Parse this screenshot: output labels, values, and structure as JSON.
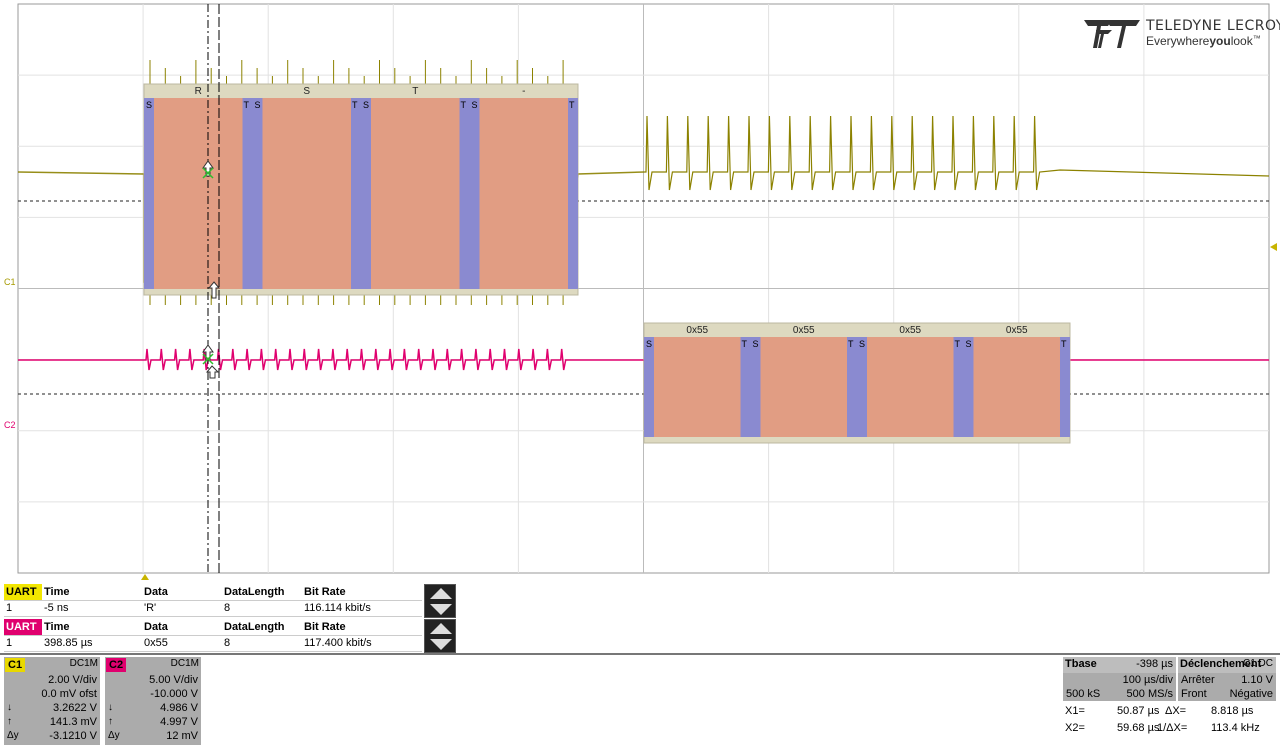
{
  "brand": {
    "name": "TELEDYNE LECROY",
    "tagline_a": "Everywhere",
    "tagline_b": "you",
    "tagline_c": "look",
    "tm": "™"
  },
  "channel_markers": {
    "c1": "C1",
    "c2": "C2"
  },
  "decode_ch1": {
    "segments": [
      {
        "start": "S",
        "char": "R",
        "end": "T"
      },
      {
        "start": "S",
        "char": "S",
        "end": "T"
      },
      {
        "start": "S",
        "char": "T",
        "end": "T"
      },
      {
        "start": "S",
        "char": "-",
        "end": "T"
      }
    ]
  },
  "decode_ch2": {
    "segments": [
      {
        "start": "S",
        "char": "0x55",
        "end": "T"
      },
      {
        "start": "S",
        "char": "0x55",
        "end": "T"
      },
      {
        "start": "S",
        "char": "0x55",
        "end": "T"
      },
      {
        "start": "S",
        "char": "0x55",
        "end": "T"
      }
    ]
  },
  "table1": {
    "tag": "UART",
    "headers": [
      "Time",
      "Data",
      "DataLength",
      "Bit Rate"
    ],
    "row": {
      "index": "1",
      "time": "-5 ns",
      "data": "'R'",
      "length": "8",
      "bitrate": "116.114 kbit/s"
    }
  },
  "table2": {
    "tag": "UART",
    "headers": [
      "Time",
      "Data",
      "DataLength",
      "Bit Rate"
    ],
    "row": {
      "index": "1",
      "time": "398.85 µs",
      "data": "0x55",
      "length": "8",
      "bitrate": "117.400 kbit/s"
    }
  },
  "c1": {
    "name": "C1",
    "coupling": "DC1M",
    "vdiv": "2.00 V/div",
    "offset": "0.0 mV ofst",
    "down_k": "↓",
    "down": "3.2622 V",
    "up_k": "↑",
    "up": "141.3 mV",
    "dy_k": "Δy",
    "dy": "-3.1210 V"
  },
  "c2": {
    "name": "C2",
    "coupling": "DC1M",
    "vdiv": "5.00 V/div",
    "offset": "-10.000 V",
    "down_k": "↓",
    "down": "4.986 V",
    "up_k": "↑",
    "up": "4.997 V",
    "dy_k": "Δy",
    "dy": "12 mV"
  },
  "timebase": {
    "label": "Tbase",
    "delay": "-398 µs",
    "tdiv": "100 µs/div",
    "samples": "500 kS",
    "rate": "500 MS/s"
  },
  "trigger": {
    "label": "Déclenchement",
    "channel": "C1 DC",
    "mode": "Arrêter",
    "level": "1.10 V",
    "type": "Front",
    "slope": "Négative"
  },
  "cursors": {
    "x1_k": "X1=",
    "x1": "50.87 µs",
    "dx_k": "ΔX=",
    "dx": "8.818 µs",
    "x2_k": "X2=",
    "x2": "59.68 µs",
    "inv_k": "1/ΔX=",
    "inv": "113.4 kHz"
  },
  "colors": {
    "ch1": "#8c8200",
    "ch2": "#e0006e",
    "decode_fill": "#e09a80",
    "decode_edge": "#8a8ad0",
    "decode_band": "#ddd9c0"
  }
}
